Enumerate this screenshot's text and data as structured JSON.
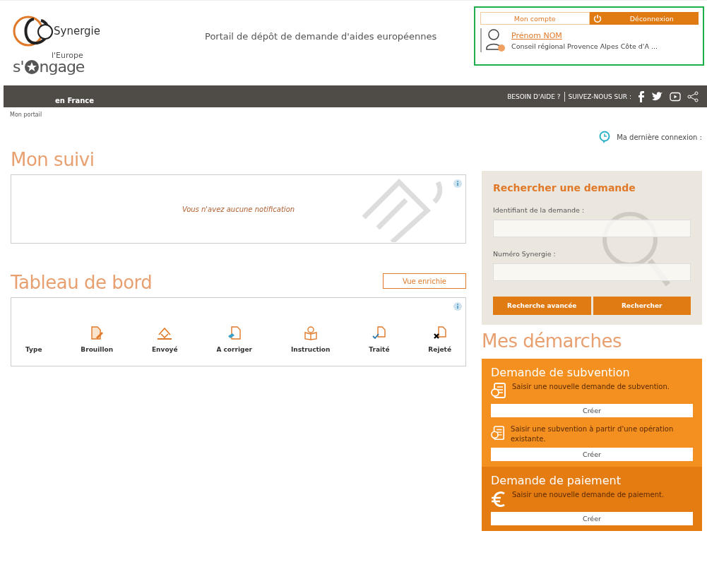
{
  "header": {
    "logo_text": "Synergie",
    "title": "Portail de dépôt de demande d'aides européennes",
    "europe_logo": {
      "line_1": "l'Europe",
      "line_2a": "s'",
      "line_2b": "ngage",
      "line_3": "en France"
    }
  },
  "account": {
    "tabs": [
      {
        "label": "Mon compte",
        "selected": true
      },
      {
        "label": "Déconnexion",
        "selected": false
      }
    ],
    "user_name": "Prénom  NOM",
    "organisation": "Conseil régional Provence Alpes Côte d'A ..."
  },
  "topbar": {
    "help": "BESOIN D'AIDE ?",
    "follow": "SUIVEZ-NOUS SUR :"
  },
  "breadcrumb": "Mon portail",
  "last_login": "Ma dernière connexion :",
  "suivi": {
    "title": "Mon suivi",
    "empty_message": "Vous n'avez aucune notification"
  },
  "tableau": {
    "title": "Tableau de bord",
    "view_button": "Vue enrichie",
    "columns": [
      {
        "label": "Type",
        "kind": "header"
      },
      {
        "label": "Brouillon",
        "kind": "draft"
      },
      {
        "label": "Envoyé",
        "kind": "sent"
      },
      {
        "label": "A corriger",
        "kind": "fix"
      },
      {
        "label": "Instruction",
        "kind": "review"
      },
      {
        "label": "Traité",
        "kind": "done"
      },
      {
        "label": "Rejeté",
        "kind": "rejected"
      }
    ]
  },
  "search": {
    "title": "Rechercher une demande",
    "fields": [
      {
        "label": "Identifiant de la demande :"
      },
      {
        "label": "Numéro Synergie :"
      }
    ],
    "buttons": [
      "Recherche avancée",
      "Rechercher"
    ]
  },
  "demarches": {
    "title": "Mes démarches",
    "sections": [
      {
        "title": "Demande de subvention",
        "color": "#f39020",
        "actions": [
          {
            "kind": "form",
            "text": "Saisir une nouvelle demande de subvention.",
            "button": "Créer"
          },
          {
            "kind": "form",
            "text": "Saisir une subvention à partir d'une opération existante.",
            "button": "Créer"
          }
        ]
      },
      {
        "title": "Demande de paiement",
        "color": "#e57c12",
        "actions": [
          {
            "kind": "euro",
            "text": "Saisir une nouvelle demande de paiement.",
            "button": "Créer"
          }
        ]
      }
    ]
  }
}
